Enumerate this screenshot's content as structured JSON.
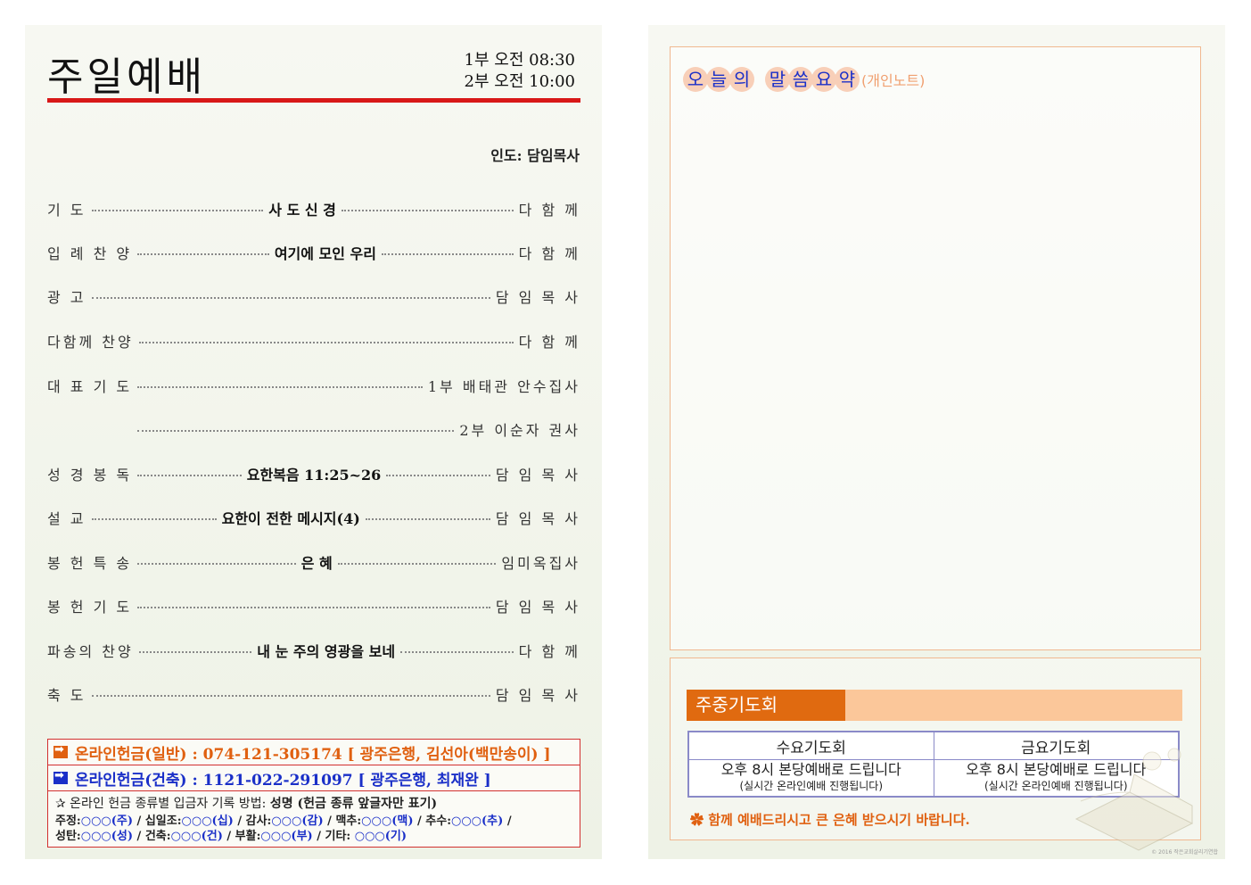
{
  "left": {
    "title": "주일예배",
    "service_times": [
      "1부 오전 08:30",
      "2부 오전 10:00"
    ],
    "leader": "인도: 담임목사",
    "order": [
      {
        "label": "기      도",
        "mid": "사 도 신 경",
        "right": "다 함 께"
      },
      {
        "label": "입 례 찬 양",
        "mid": "여기에 모인 우리",
        "right": "다 함 께"
      },
      {
        "label": "광      고",
        "mid": "",
        "right": "담 임 목 사"
      },
      {
        "label": "다함께 찬양",
        "mid": "",
        "right": "다  함  께"
      },
      {
        "label": "대 표 기 도",
        "mid": "",
        "right": "1부 배태관 안수집사"
      },
      {
        "label": "",
        "mid": "",
        "right": "2부 이순자 권사"
      },
      {
        "label": "성 경 봉 독",
        "mid": "요한복음 11:25~26",
        "right": "담 임 목 사"
      },
      {
        "label": "설      교",
        "mid": "요한이 전한 메시지(4)",
        "right": "담 임 목 사"
      },
      {
        "label": "봉 헌 특 송",
        "mid": "은 혜",
        "right": "임미옥집사"
      },
      {
        "label": "봉 헌 기 도",
        "mid": "",
        "right": "담 임 목 사"
      },
      {
        "label": "파송의 찬양",
        "mid": "내 눈 주의 영광을 보네",
        "right": "다  함  께"
      },
      {
        "label": "축      도",
        "mid": "",
        "right": "담 임 목 사"
      }
    ],
    "offering": {
      "general": "온라인헌금(일반) : 074-121-305174 [ 광주은행, 김선아(백만송이) ]",
      "building": "온라인헌금(건축) : 1121-022-291097 [ 광주은행, 최재완 ]",
      "note_prefix": "✰ 온라인 헌금 종류별 입금자 기록 방법: ",
      "note_bold": "성명 (헌금 종류 앞글자만 표기)",
      "codes_line1": [
        {
          "k": "주정:",
          "v": "○○○(주)"
        },
        {
          "k": " / 십일조:",
          "v": "○○○(십)"
        },
        {
          "k": " / 감사:",
          "v": "○○○(감)"
        },
        {
          "k": " / 맥추:",
          "v": "○○○(맥)"
        },
        {
          "k": " / 추수:",
          "v": "○○○(추)"
        },
        {
          "k": " /",
          "v": ""
        }
      ],
      "codes_line2": [
        {
          "k": "성탄:",
          "v": "○○○(성)"
        },
        {
          "k": " / 건축:",
          "v": "○○○(건)"
        },
        {
          "k": " / 부활:",
          "v": "○○○(부)"
        },
        {
          "k": " / 기타: ",
          "v": "○○○(기)"
        }
      ]
    }
  },
  "right": {
    "word_title_chars": [
      "오",
      "늘",
      "의",
      "",
      "말",
      "씀",
      "요",
      "약"
    ],
    "word_title_note": "(개인노트)",
    "prayer_header": "주중기도회",
    "prayer_cols": [
      {
        "head": "수요기도회",
        "main": "오후 8시 본당예배로 드립니다",
        "sub": "(실시간 온라인예배 진행됩니다)"
      },
      {
        "head": "금요기도회",
        "main": "오후 8시 본당예배로 드립니다",
        "sub": "(실시간 온라인예배 진행됩니다)"
      }
    ],
    "blessing": "✿ 함께 예배드리시고 큰 은혜 받으시기 바랍니다.",
    "copyright": "© 2016 작은교회살리기연합"
  },
  "colors": {
    "rule": "#d81818",
    "accent_orange": "#e06010",
    "accent_blue": "#1a2fc8"
  }
}
